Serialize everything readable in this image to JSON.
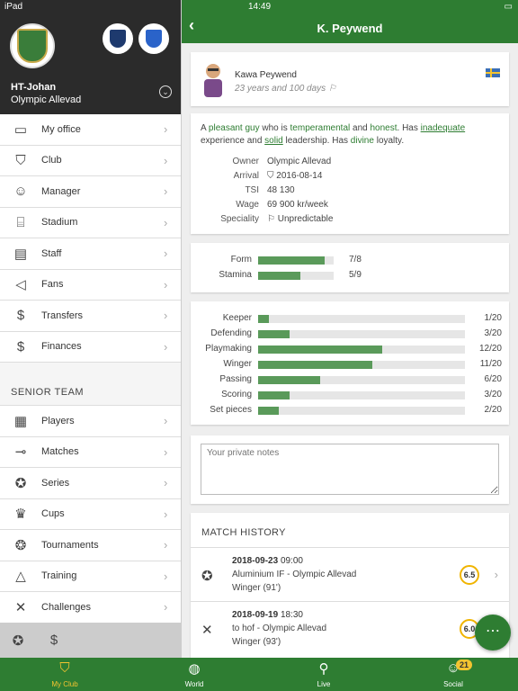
{
  "status": {
    "device": "iPad",
    "time": "14:49",
    "battery": "▭"
  },
  "sidebar": {
    "user": "HT-Johan",
    "club": "Olympic Allevad",
    "menu": [
      {
        "label": "My office",
        "icon": "desk-icon",
        "glyph": "▭"
      },
      {
        "label": "Club",
        "icon": "club-shield-icon",
        "glyph": "⛉"
      },
      {
        "label": "Manager",
        "icon": "manager-icon",
        "glyph": "☺"
      },
      {
        "label": "Stadium",
        "icon": "stadium-icon",
        "glyph": "⌸"
      },
      {
        "label": "Staff",
        "icon": "briefcase-icon",
        "glyph": "▤"
      },
      {
        "label": "Fans",
        "icon": "megaphone-icon",
        "glyph": "◁"
      },
      {
        "label": "Transfers",
        "icon": "shirt-dollar-icon",
        "glyph": "$"
      },
      {
        "label": "Finances",
        "icon": "money-icon",
        "glyph": "$"
      }
    ],
    "section_title": "SENIOR TEAM",
    "team_menu": [
      {
        "label": "Players",
        "icon": "shirts-icon",
        "glyph": "▦"
      },
      {
        "label": "Matches",
        "icon": "whistle-icon",
        "glyph": "⊸"
      },
      {
        "label": "Series",
        "icon": "medal-icon",
        "glyph": "✪"
      },
      {
        "label": "Cups",
        "icon": "cup-icon",
        "glyph": "♛"
      },
      {
        "label": "Tournaments",
        "icon": "laurel-icon",
        "glyph": "❂"
      },
      {
        "label": "Training",
        "icon": "cone-icon",
        "glyph": "△"
      },
      {
        "label": "Challenges",
        "icon": "crossed-flags-icon",
        "glyph": "✕"
      }
    ],
    "footer_icons": [
      "✪",
      "$"
    ]
  },
  "header": {
    "title": "K. Peywend"
  },
  "player": {
    "full_name": "Kawa Peywend",
    "age": "23 years and 100 days",
    "flag_color": "#3b6fb6"
  },
  "description": {
    "p1": "A ",
    "pleasant": "pleasant guy",
    "p2": " who is ",
    "temperamental": "temperamental",
    "p3": " and ",
    "honest": "honest",
    "p4": ". Has ",
    "inadequate": "inadequate",
    "p5": " experience and ",
    "solid": "solid",
    "p6": " leadership. Has ",
    "divine": "divine",
    "p7": " loyalty."
  },
  "details": [
    {
      "key": "Owner",
      "value": "Olympic Allevad"
    },
    {
      "key": "Arrival",
      "value": "⛉  2016-08-14"
    },
    {
      "key": "TSI",
      "value": "48 130"
    },
    {
      "key": "Wage",
      "value": "69 900 kr/week"
    },
    {
      "key": "Speciality",
      "value": "⚐  Unpredictable"
    }
  ],
  "condition": [
    {
      "label": "Form",
      "value": 7,
      "max": 8,
      "text": "7/8"
    },
    {
      "label": "Stamina",
      "value": 5,
      "max": 9,
      "text": "5/9"
    }
  ],
  "skills": [
    {
      "label": "Keeper",
      "value": 1,
      "max": 20,
      "text": "1/20"
    },
    {
      "label": "Defending",
      "value": 3,
      "max": 20,
      "text": "3/20"
    },
    {
      "label": "Playmaking",
      "value": 12,
      "max": 20,
      "text": "12/20"
    },
    {
      "label": "Winger",
      "value": 11,
      "max": 20,
      "text": "11/20"
    },
    {
      "label": "Passing",
      "value": 6,
      "max": 20,
      "text": "6/20"
    },
    {
      "label": "Scoring",
      "value": 3,
      "max": 20,
      "text": "3/20"
    },
    {
      "label": "Set pieces",
      "value": 2,
      "max": 20,
      "text": "2/20"
    }
  ],
  "notes": {
    "placeholder": "Your private notes"
  },
  "match_history": {
    "title": "MATCH HISTORY",
    "matches": [
      {
        "date": "2018-09-23",
        "time": "09:00",
        "teams": "Aluminium IF  -  Olympic Allevad",
        "position": "Winger (91')",
        "rating": "6.5",
        "icon": "medal-icon",
        "glyph": "✪"
      },
      {
        "date": "2018-09-19",
        "time": "18:30",
        "teams": "to hof  -  Olympic Allevad",
        "position": "Winger (93')",
        "rating": "6.0",
        "icon": "crossed-flags-icon",
        "glyph": "✕"
      }
    ]
  },
  "fab": "⋯",
  "tabs": [
    {
      "label": "My Club",
      "icon": "club-shield-icon",
      "glyph": "⛉"
    },
    {
      "label": "World",
      "icon": "globe-icon",
      "glyph": "◍"
    },
    {
      "label": "Live",
      "icon": "live-icon",
      "glyph": "⚲"
    },
    {
      "label": "Social",
      "icon": "social-icon",
      "glyph": "☺"
    }
  ],
  "social_badge": "21",
  "colors": {
    "accent": "#2e7d32",
    "bar": "#5a9a5a",
    "badge": "#f4c430"
  }
}
